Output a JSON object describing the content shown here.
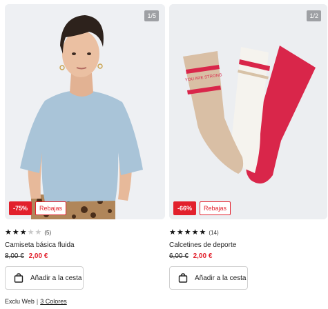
{
  "products": [
    {
      "counter": "1/5",
      "discount": "-75%",
      "sale_label": "Rebajas",
      "rating": 3,
      "rating_max": 5,
      "review_count": "(5)",
      "title": "Camiseta básica fluida",
      "old_price": "8,00 €",
      "new_price": "2,00 €",
      "button_label": "Añadir a la cesta",
      "tag": "Exclu Web",
      "colors_link": "3 Colores"
    },
    {
      "counter": "1/2",
      "discount": "-66%",
      "sale_label": "Rebajas",
      "rating": 5,
      "rating_max": 5,
      "review_count": "(14)",
      "title": "Calcetines de deporte",
      "old_price": "6,00 €",
      "new_price": "2,00 €",
      "button_label": "Añadir a la cesta",
      "sock_text": "YOU ARE STRONG"
    }
  ],
  "colors": {
    "discount_red": "#e2202c",
    "star_full": "#111111",
    "star_empty": "#c8c8c8",
    "shirt_blue": "#a9c4d8",
    "sock_beige": "#d9bfa5",
    "sock_red": "#d9264a"
  },
  "icons": {
    "cart": "shopping-bag-icon",
    "star": "star-icon"
  }
}
